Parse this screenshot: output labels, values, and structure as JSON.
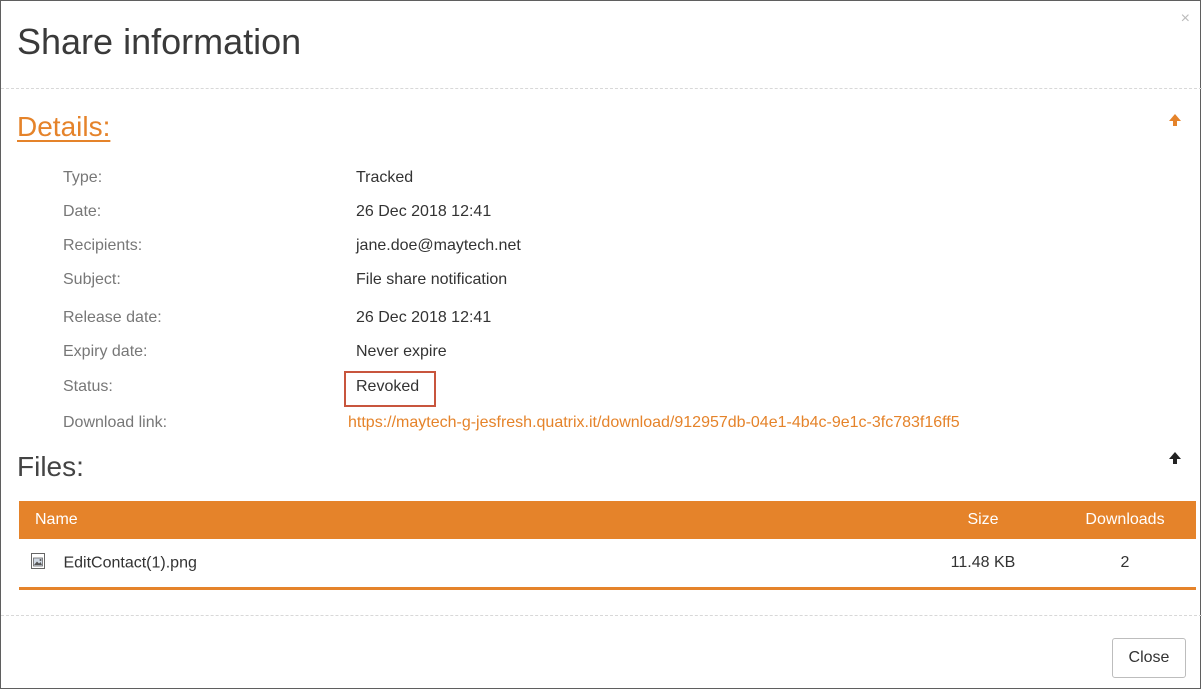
{
  "dialog": {
    "title": "Share information",
    "close_glyph": "×"
  },
  "details": {
    "title": "Details:",
    "rows": [
      {
        "label": "Type:",
        "value": "Tracked"
      },
      {
        "label": "Date:",
        "value": "26 Dec 2018 12:41"
      },
      {
        "label": "Recipients:",
        "value": "jane.doe@maytech.net"
      },
      {
        "label": "Subject:",
        "value": "File share notification"
      },
      {
        "label": "Release date:",
        "value": "26 Dec 2018 12:41"
      },
      {
        "label": "Expiry date:",
        "value": "Never expire"
      },
      {
        "label": "Status:",
        "value": "Revoked"
      },
      {
        "label": "Download link:",
        "value": "https://maytech-g-jesfresh.quatrix.it/download/912957db-04e1-4b4c-9e1c-3fc783f16ff5"
      }
    ]
  },
  "files": {
    "title": "Files:",
    "columns": {
      "name": "Name",
      "size": "Size",
      "downloads": "Downloads"
    },
    "rows": [
      {
        "name": "EditContact(1).png",
        "size": "11.48 KB",
        "downloads": "2",
        "icon": "image-file-icon"
      }
    ]
  },
  "footer": {
    "close_label": "Close"
  },
  "colors": {
    "accent": "#e5832a",
    "highlight_box": "#c8553d"
  }
}
